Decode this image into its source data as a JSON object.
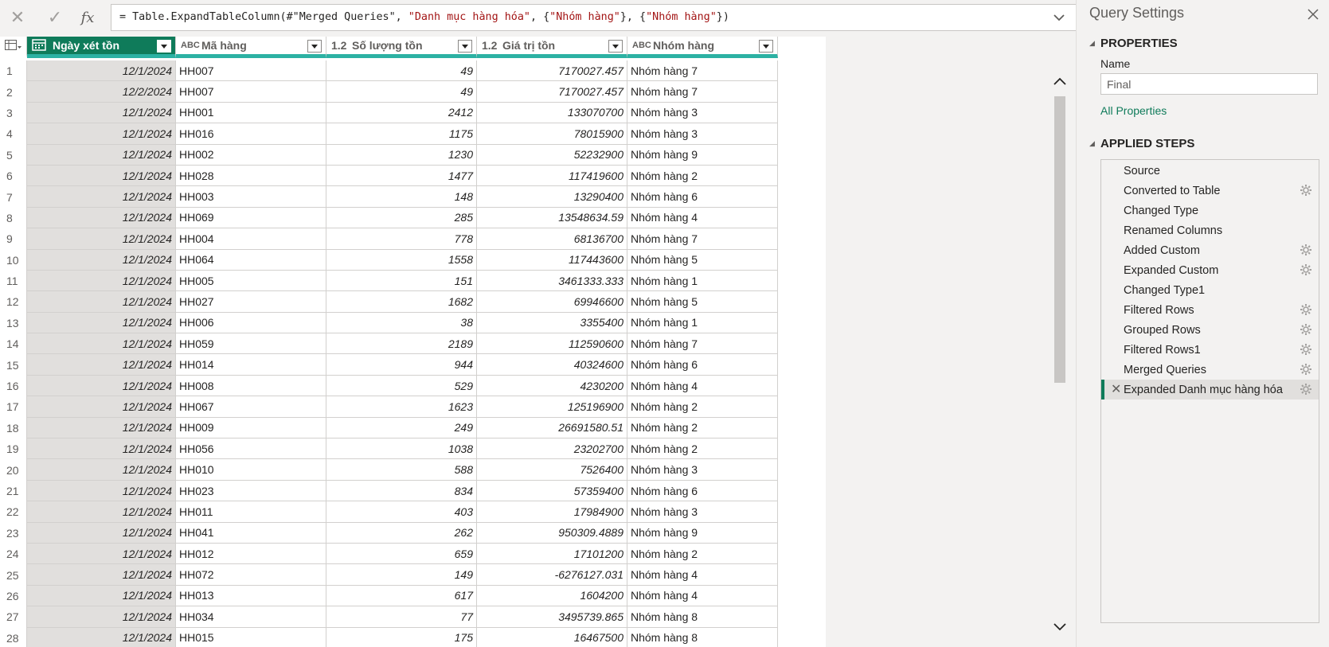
{
  "formula": {
    "prefix": "= Table.ExpandTableColumn(#\"Merged Queries\", ",
    "arg1": "\"Danh mục hàng hóa\"",
    "mid1": ", {",
    "arg2": "\"Nhóm hàng\"",
    "mid2": "}, {",
    "arg3": "\"Nhóm hàng\"",
    "suffix": "})"
  },
  "columns": [
    {
      "type": "",
      "label": "Ngày xét tồn"
    },
    {
      "type": "ABC",
      "label": "Mã hàng"
    },
    {
      "type": "1.2",
      "label": "Số lượng tồn"
    },
    {
      "type": "1.2",
      "label": "Giá trị tồn"
    },
    {
      "type": "ABC",
      "label": "Nhóm hàng"
    }
  ],
  "rows": [
    [
      "1",
      "12/1/2024",
      "HH007",
      "49",
      "7170027.457",
      "Nhóm hàng 7"
    ],
    [
      "2",
      "12/2/2024",
      "HH007",
      "49",
      "7170027.457",
      "Nhóm hàng 7"
    ],
    [
      "3",
      "12/1/2024",
      "HH001",
      "2412",
      "133070700",
      "Nhóm hàng 3"
    ],
    [
      "4",
      "12/1/2024",
      "HH016",
      "1175",
      "78015900",
      "Nhóm hàng 3"
    ],
    [
      "5",
      "12/1/2024",
      "HH002",
      "1230",
      "52232900",
      "Nhóm hàng 9"
    ],
    [
      "6",
      "12/1/2024",
      "HH028",
      "1477",
      "117419600",
      "Nhóm hàng 2"
    ],
    [
      "7",
      "12/1/2024",
      "HH003",
      "148",
      "13290400",
      "Nhóm hàng 6"
    ],
    [
      "8",
      "12/1/2024",
      "HH069",
      "285",
      "13548634.59",
      "Nhóm hàng 4"
    ],
    [
      "9",
      "12/1/2024",
      "HH004",
      "778",
      "68136700",
      "Nhóm hàng 7"
    ],
    [
      "10",
      "12/1/2024",
      "HH064",
      "1558",
      "117443600",
      "Nhóm hàng 5"
    ],
    [
      "11",
      "12/1/2024",
      "HH005",
      "151",
      "3461333.333",
      "Nhóm hàng 1"
    ],
    [
      "12",
      "12/1/2024",
      "HH027",
      "1682",
      "69946600",
      "Nhóm hàng 5"
    ],
    [
      "13",
      "12/1/2024",
      "HH006",
      "38",
      "3355400",
      "Nhóm hàng 1"
    ],
    [
      "14",
      "12/1/2024",
      "HH059",
      "2189",
      "112590600",
      "Nhóm hàng 7"
    ],
    [
      "15",
      "12/1/2024",
      "HH014",
      "944",
      "40324600",
      "Nhóm hàng 6"
    ],
    [
      "16",
      "12/1/2024",
      "HH008",
      "529",
      "4230200",
      "Nhóm hàng 4"
    ],
    [
      "17",
      "12/1/2024",
      "HH067",
      "1623",
      "125196900",
      "Nhóm hàng 2"
    ],
    [
      "18",
      "12/1/2024",
      "HH009",
      "249",
      "26691580.51",
      "Nhóm hàng 2"
    ],
    [
      "19",
      "12/1/2024",
      "HH056",
      "1038",
      "23202700",
      "Nhóm hàng 2"
    ],
    [
      "20",
      "12/1/2024",
      "HH010",
      "588",
      "7526400",
      "Nhóm hàng 3"
    ],
    [
      "21",
      "12/1/2024",
      "HH023",
      "834",
      "57359400",
      "Nhóm hàng 6"
    ],
    [
      "22",
      "12/1/2024",
      "HH011",
      "403",
      "17984900",
      "Nhóm hàng 3"
    ],
    [
      "23",
      "12/1/2024",
      "HH041",
      "262",
      "950309.4889",
      "Nhóm hàng 9"
    ],
    [
      "24",
      "12/1/2024",
      "HH012",
      "659",
      "17101200",
      "Nhóm hàng 2"
    ],
    [
      "25",
      "12/1/2024",
      "HH072",
      "149",
      "-6276127.031",
      "Nhóm hàng 4"
    ],
    [
      "26",
      "12/1/2024",
      "HH013",
      "617",
      "1604200",
      "Nhóm hàng 4"
    ],
    [
      "27",
      "12/1/2024",
      "HH034",
      "77",
      "3495739.865",
      "Nhóm hàng 8"
    ],
    [
      "28",
      "12/1/2024",
      "HH015",
      "175",
      "16467500",
      "Nhóm hàng 8"
    ]
  ],
  "settings": {
    "title": "Query Settings",
    "properties_head": "PROPERTIES",
    "name_label": "Name",
    "name_value": "Final",
    "all_properties": "All Properties",
    "steps_head": "APPLIED STEPS",
    "steps": [
      {
        "label": "Source",
        "gear": false
      },
      {
        "label": "Converted to Table",
        "gear": true
      },
      {
        "label": "Changed Type",
        "gear": false
      },
      {
        "label": "Renamed Columns",
        "gear": false
      },
      {
        "label": "Added Custom",
        "gear": true
      },
      {
        "label": "Expanded Custom",
        "gear": true
      },
      {
        "label": "Changed Type1",
        "gear": false
      },
      {
        "label": "Filtered Rows",
        "gear": true
      },
      {
        "label": "Grouped Rows",
        "gear": true
      },
      {
        "label": "Filtered Rows1",
        "gear": true
      },
      {
        "label": "Merged Queries",
        "gear": true
      },
      {
        "label": "Expanded Danh mục hàng hóa",
        "gear": true,
        "active": true
      }
    ]
  }
}
